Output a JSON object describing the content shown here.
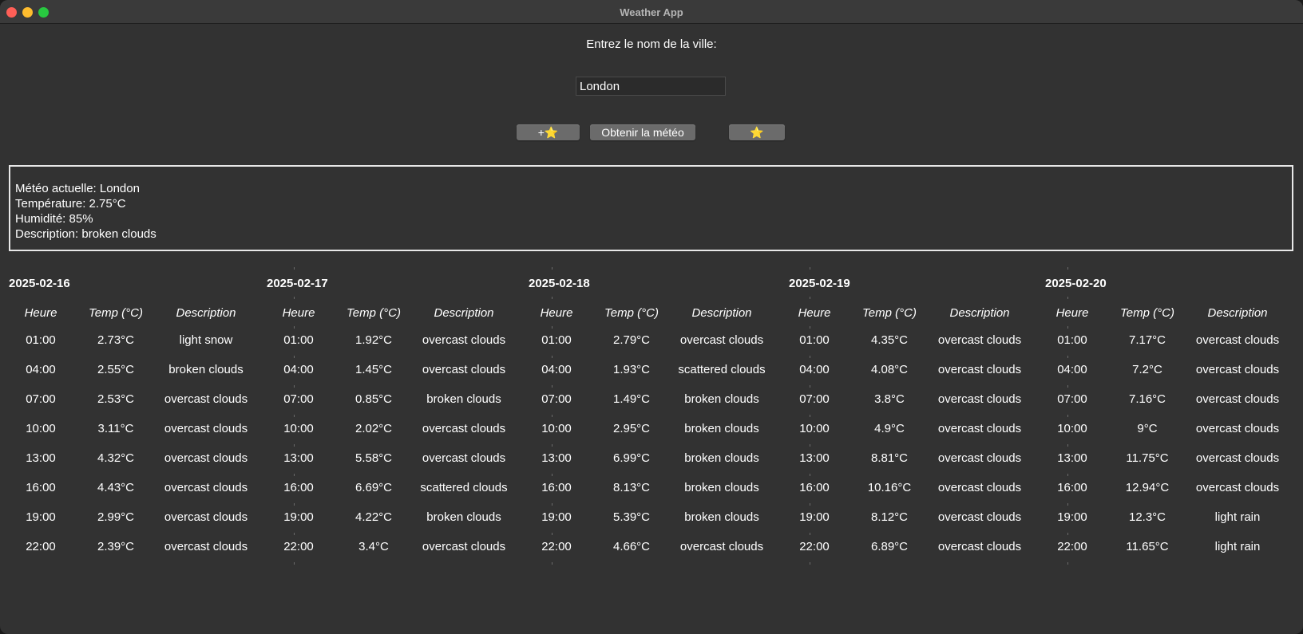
{
  "window": {
    "title": "Weather App"
  },
  "search": {
    "prompt": "Entrez le nom de la ville:",
    "city_value": "London"
  },
  "buttons": {
    "add_favorite": "+⭐",
    "get_weather": "Obtenir la météo",
    "favorites": "⭐"
  },
  "current": {
    "line1": "Météo actuelle: London",
    "line2": "Température: 2.75°C",
    "line3": "Humidité: 85%",
    "line4": "Description: broken clouds"
  },
  "columns": {
    "hour": "Heure",
    "temp": "Temp (°C)",
    "desc": "Description"
  },
  "forecast": [
    {
      "date": "2025-02-16",
      "rows": [
        [
          "01:00",
          "2.73°C",
          "light snow"
        ],
        [
          "04:00",
          "2.55°C",
          "broken clouds"
        ],
        [
          "07:00",
          "2.53°C",
          "overcast clouds"
        ],
        [
          "10:00",
          "3.11°C",
          "overcast clouds"
        ],
        [
          "13:00",
          "4.32°C",
          "overcast clouds"
        ],
        [
          "16:00",
          "4.43°C",
          "overcast clouds"
        ],
        [
          "19:00",
          "2.99°C",
          "overcast clouds"
        ],
        [
          "22:00",
          "2.39°C",
          "overcast clouds"
        ]
      ]
    },
    {
      "date": "2025-02-17",
      "rows": [
        [
          "01:00",
          "1.92°C",
          "overcast clouds"
        ],
        [
          "04:00",
          "1.45°C",
          "overcast clouds"
        ],
        [
          "07:00",
          "0.85°C",
          "broken clouds"
        ],
        [
          "10:00",
          "2.02°C",
          "overcast clouds"
        ],
        [
          "13:00",
          "5.58°C",
          "overcast clouds"
        ],
        [
          "16:00",
          "6.69°C",
          "scattered clouds"
        ],
        [
          "19:00",
          "4.22°C",
          "broken clouds"
        ],
        [
          "22:00",
          "3.4°C",
          "overcast clouds"
        ]
      ]
    },
    {
      "date": "2025-02-18",
      "rows": [
        [
          "01:00",
          "2.79°C",
          "overcast clouds"
        ],
        [
          "04:00",
          "1.93°C",
          "scattered clouds"
        ],
        [
          "07:00",
          "1.49°C",
          "broken clouds"
        ],
        [
          "10:00",
          "2.95°C",
          "broken clouds"
        ],
        [
          "13:00",
          "6.99°C",
          "broken clouds"
        ],
        [
          "16:00",
          "8.13°C",
          "broken clouds"
        ],
        [
          "19:00",
          "5.39°C",
          "broken clouds"
        ],
        [
          "22:00",
          "4.66°C",
          "overcast clouds"
        ]
      ]
    },
    {
      "date": "2025-02-19",
      "rows": [
        [
          "01:00",
          "4.35°C",
          "overcast clouds"
        ],
        [
          "04:00",
          "4.08°C",
          "overcast clouds"
        ],
        [
          "07:00",
          "3.8°C",
          "overcast clouds"
        ],
        [
          "10:00",
          "4.9°C",
          "overcast clouds"
        ],
        [
          "13:00",
          "8.81°C",
          "overcast clouds"
        ],
        [
          "16:00",
          "10.16°C",
          "overcast clouds"
        ],
        [
          "19:00",
          "8.12°C",
          "overcast clouds"
        ],
        [
          "22:00",
          "6.89°C",
          "overcast clouds"
        ]
      ]
    },
    {
      "date": "2025-02-20",
      "rows": [
        [
          "01:00",
          "7.17°C",
          "overcast clouds"
        ],
        [
          "04:00",
          "7.2°C",
          "overcast clouds"
        ],
        [
          "07:00",
          "7.16°C",
          "overcast clouds"
        ],
        [
          "10:00",
          "9°C",
          "overcast clouds"
        ],
        [
          "13:00",
          "11.75°C",
          "overcast clouds"
        ],
        [
          "16:00",
          "12.94°C",
          "overcast clouds"
        ],
        [
          "19:00",
          "12.3°C",
          "light rain"
        ],
        [
          "22:00",
          "11.65°C",
          "light rain"
        ]
      ]
    }
  ]
}
